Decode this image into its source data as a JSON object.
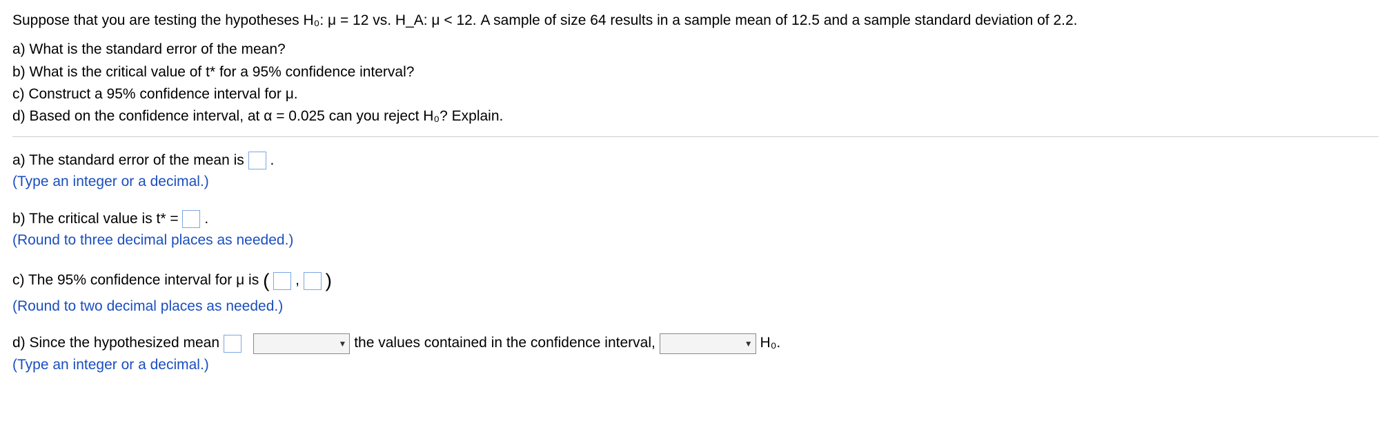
{
  "intro": {
    "line1": "Suppose that you are testing the hypotheses H₀: μ = 12 vs. H_A: μ < 12. A sample of size 64 results in a sample mean of 12.5 and a sample standard deviation of 2.2."
  },
  "questions": {
    "a": "a) What is the standard error of the mean?",
    "b": "b) What is the critical value of t* for a 95% confidence interval?",
    "c": "c) Construct a 95% confidence interval for μ.",
    "d": "d) Based on the confidence interval, at α = 0.025 can you reject H₀? Explain."
  },
  "answers": {
    "a": {
      "prefix": "a) The standard error of the mean is ",
      "suffix": ".",
      "hint": "(Type an integer or a decimal.)"
    },
    "b": {
      "prefix": "b) The critical value is t* = ",
      "suffix": ".",
      "hint": "(Round to three decimal places as needed.)"
    },
    "c": {
      "prefix": "c) The 95% confidence interval for μ is ",
      "open": "(",
      "sep": ",",
      "close": ")",
      "hint": "(Round to two decimal places as needed.)"
    },
    "d": {
      "prefix": "d) Since the hypothesized mean ",
      "mid": " the values contained in the confidence interval, ",
      "tail": " H₀.",
      "hint": "(Type an integer or a decimal.)"
    }
  }
}
